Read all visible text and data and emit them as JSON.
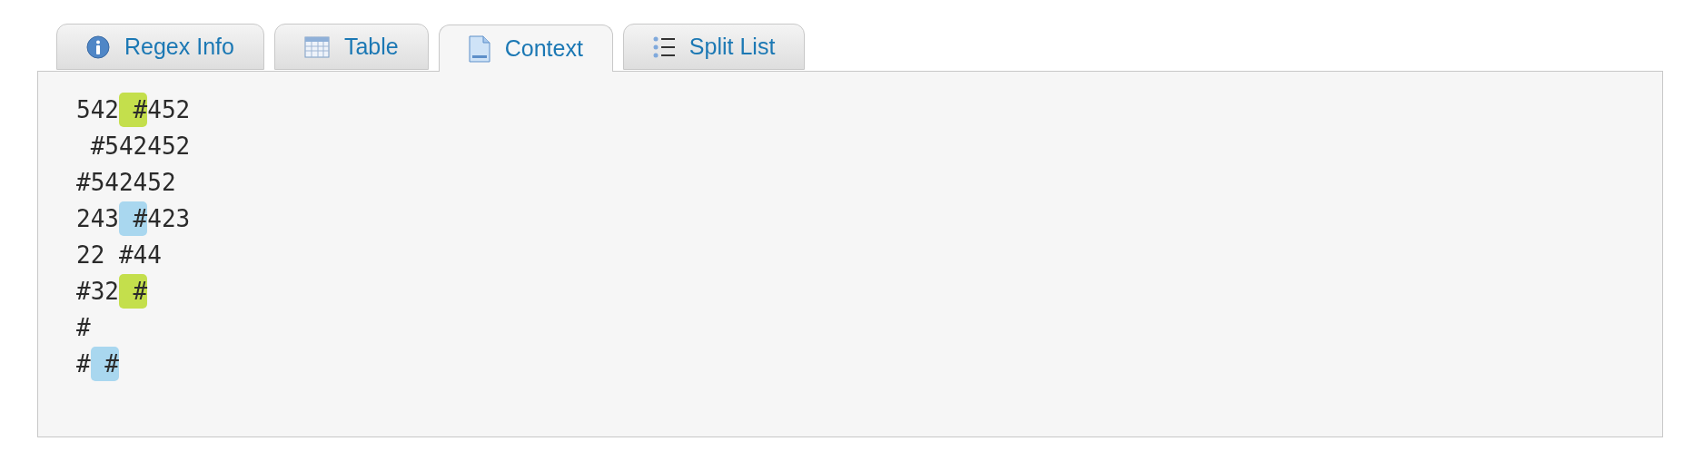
{
  "tabs": [
    {
      "label": "Regex Info",
      "kind": "info",
      "selected": false
    },
    {
      "label": "Table",
      "kind": "table",
      "selected": false
    },
    {
      "label": "Context",
      "kind": "document",
      "selected": true
    },
    {
      "label": "Split List",
      "kind": "list",
      "selected": false
    }
  ],
  "context_lines": [
    [
      {
        "kind": "plain",
        "text": "542"
      },
      {
        "kind": "match",
        "text": " #",
        "color": "#c4df4c"
      },
      {
        "kind": "plain",
        "text": "452"
      }
    ],
    [
      {
        "kind": "plain",
        "text": " #542452"
      }
    ],
    [
      {
        "kind": "plain",
        "text": "#542452"
      }
    ],
    [
      {
        "kind": "plain",
        "text": "243"
      },
      {
        "kind": "match",
        "text": " #",
        "color": "#a9d7ef"
      },
      {
        "kind": "plain",
        "text": "423"
      }
    ],
    [
      {
        "kind": "plain",
        "text": "22 #44"
      }
    ],
    [
      {
        "kind": "plain",
        "text": "#32"
      },
      {
        "kind": "match",
        "text": " #",
        "color": "#c4df4c"
      }
    ],
    [
      {
        "kind": "plain",
        "text": "#"
      }
    ],
    [
      {
        "kind": "plain",
        "text": "#"
      },
      {
        "kind": "match",
        "text": " #",
        "color": "#a9d7ef"
      }
    ]
  ]
}
